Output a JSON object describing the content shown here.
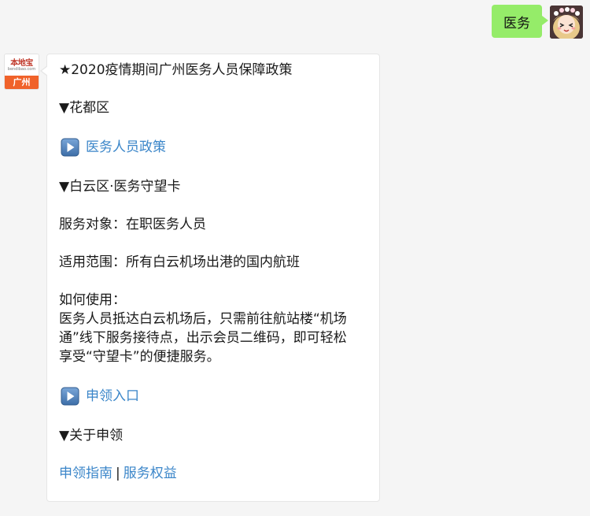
{
  "user_message": {
    "text": "医务"
  },
  "bot_avatar": {
    "brand": "本地宝",
    "url": "bendibao.com",
    "city": "广州"
  },
  "bot_message": {
    "title": "★2020疫情期间广州医务人员保障政策",
    "section1_heading": "▼花都区",
    "section1_link": "医务人员政策",
    "section2_heading": "▼白云区·医务守望卡",
    "service_target": "服务对象：在职医务人员",
    "scope": "适用范围：所有白云机场出港的国内航班",
    "howto_label": "如何使用：",
    "howto_lines": [
      "医务人员抵达白云机场后，只需前往航站楼“机场",
      "通”线下服务接待点，出示会员二维码，即可轻松",
      "享受“守望卡”的便捷服务。"
    ],
    "section2_link": "申领入口",
    "section3_heading": "▼关于申领",
    "guide_link": "申领指南",
    "separator": "|",
    "rights_link": "服务权益"
  },
  "icons": {
    "play": "play-button-icon"
  },
  "colors": {
    "background": "#f5f5f5",
    "user_bubble": "#95ec69",
    "bot_bubble": "#ffffff",
    "link": "#3b86c9",
    "logo_orange": "#f0622a"
  }
}
